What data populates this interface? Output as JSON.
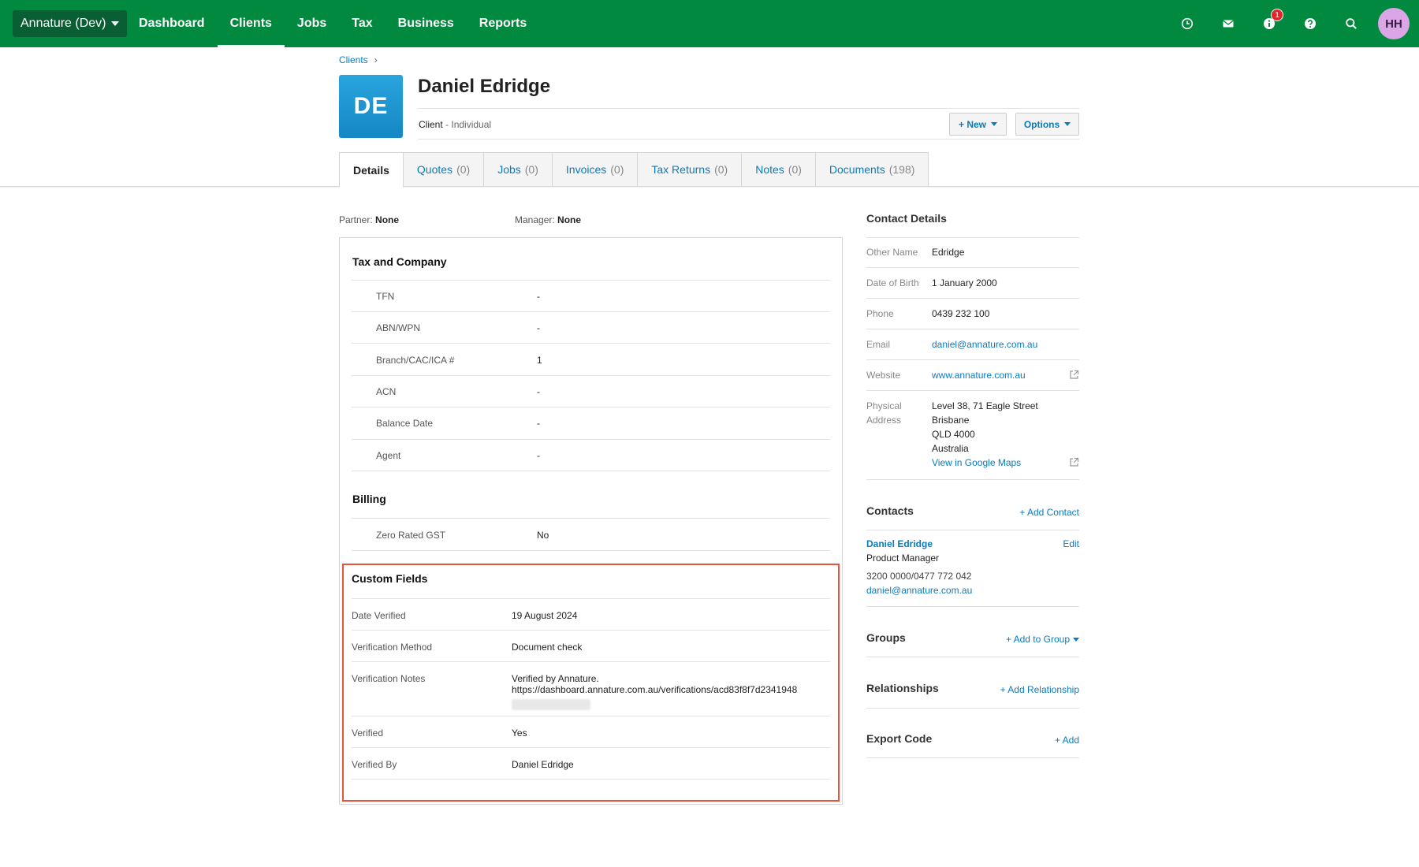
{
  "topnav": {
    "org": "Annature (Dev)",
    "links": [
      "Dashboard",
      "Clients",
      "Jobs",
      "Tax",
      "Business",
      "Reports"
    ],
    "notification_count": "1",
    "avatar_initials": "HH"
  },
  "header": {
    "breadcrumb": "Clients",
    "breadcrumb_sep": "›",
    "avatar_initials": "DE",
    "name": "Daniel Edridge",
    "type_prefix": "Client",
    "type_suffix": "- Individual",
    "new_button": "+ New",
    "options_button": "Options"
  },
  "tabs": [
    {
      "label": "Details",
      "count": ""
    },
    {
      "label": "Quotes",
      "count": "(0)"
    },
    {
      "label": "Jobs",
      "count": "(0)"
    },
    {
      "label": "Invoices",
      "count": "(0)"
    },
    {
      "label": "Tax Returns",
      "count": "(0)"
    },
    {
      "label": "Notes",
      "count": "(0)"
    },
    {
      "label": "Documents",
      "count": "(198)"
    }
  ],
  "details": {
    "partner_label": "Partner:",
    "partner_value": "None",
    "manager_label": "Manager:",
    "manager_value": "None",
    "tax_title": "Tax and Company",
    "tax_rows": [
      {
        "label": "TFN",
        "value": "-"
      },
      {
        "label": "ABN/WPN",
        "value": "-"
      },
      {
        "label": "Branch/CAC/ICA #",
        "value": "1"
      },
      {
        "label": "ACN",
        "value": "-"
      },
      {
        "label": "Balance Date",
        "value": "-"
      },
      {
        "label": "Agent",
        "value": "-"
      }
    ],
    "billing_title": "Billing",
    "billing_rows": [
      {
        "label": "Zero Rated GST",
        "value": "No"
      }
    ],
    "custom_title": "Custom Fields",
    "custom_rows": [
      {
        "label": "Date Verified",
        "value": "19 August 2024"
      },
      {
        "label": "Verification Method",
        "value": "Document check"
      },
      {
        "label": "Verification Notes",
        "value": "Verified by Annature.",
        "value2": "https://dashboard.annature.com.au/verifications/acd83f8f7d2341948"
      },
      {
        "label": "Verified",
        "value": "Yes"
      },
      {
        "label": "Verified By",
        "value": "Daniel Edridge"
      }
    ]
  },
  "contact_details": {
    "title": "Contact Details",
    "other_name_label": "Other Name",
    "other_name": "Edridge",
    "dob_label": "Date of Birth",
    "dob": "1 January 2000",
    "phone_label": "Phone",
    "phone": "0439 232 100",
    "email_label": "Email",
    "email": "daniel@annature.com.au",
    "website_label": "Website",
    "website": "www.annature.com.au",
    "address_label_1": "Physical",
    "address_label_2": "Address",
    "address_1": "Level 38, 71 Eagle Street",
    "address_2": "Brisbane",
    "address_3": "QLD 4000",
    "address_4": "Australia",
    "maps_link": "View in Google Maps"
  },
  "contacts": {
    "title": "Contacts",
    "add": "+ Add Contact",
    "name": "Daniel Edridge",
    "edit": "Edit",
    "role": "Product Manager",
    "phones": "3200 0000/0477 772 042",
    "email": "daniel@annature.com.au"
  },
  "groups": {
    "title": "Groups",
    "add": "+ Add to Group"
  },
  "relationships": {
    "title": "Relationships",
    "add": "+ Add Relationship"
  },
  "export_code": {
    "title": "Export Code",
    "add": "+ Add"
  }
}
